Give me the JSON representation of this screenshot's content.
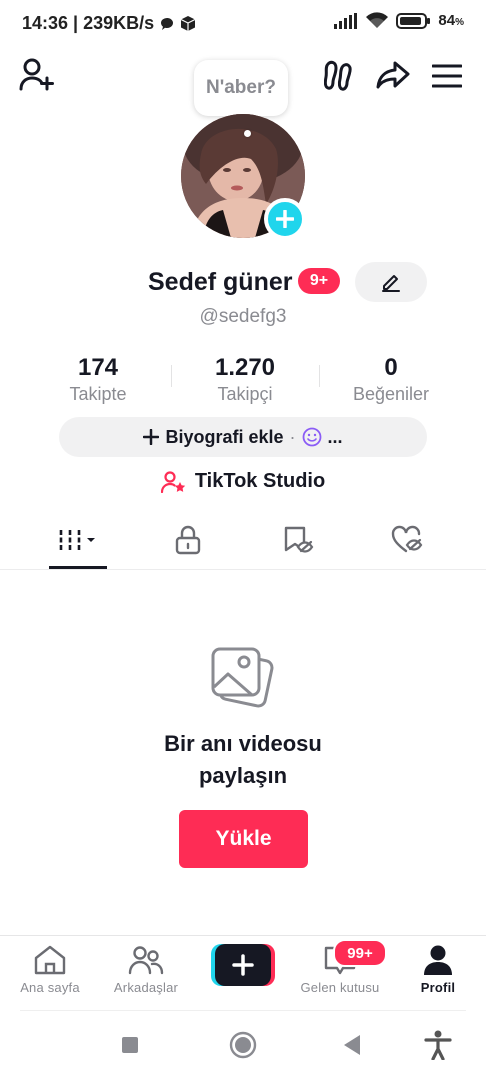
{
  "status": {
    "time_speed": "14:36 | 239KB/s",
    "battery": "84",
    "battery_unit": "%",
    "icons": [
      "chat-bubble-icon",
      "package-icon",
      "signal-icon",
      "wifi-icon",
      "battery-icon"
    ]
  },
  "header": {
    "icons": [
      "add-friend-icon",
      "footprints-icon",
      "share-icon",
      "menu-icon"
    ],
    "note_bubble": "N'aber?"
  },
  "profile": {
    "name": "Sedef güner",
    "notif_badge": "9+",
    "handle": "@sedefg3",
    "stats": [
      {
        "value": "174",
        "label": "Takipte"
      },
      {
        "value": "1.270",
        "label": "Takipçi"
      },
      {
        "value": "0",
        "label": "Beğeniler"
      }
    ],
    "bio_button": "Biyografi ekle",
    "bio_sep": "·",
    "bio_more": "...",
    "studio": "TikTok Studio"
  },
  "tabs": [
    "videos-grid-icon",
    "lock-icon",
    "saved-icon",
    "liked-icon"
  ],
  "empty": {
    "title_line1": "Bir anı videosu",
    "title_line2": "paylaşın",
    "button": "Yükle"
  },
  "bottom_nav": {
    "items": [
      {
        "label": "Ana sayfa",
        "icon": "home-icon"
      },
      {
        "label": "Arkadaşlar",
        "icon": "friends-icon"
      },
      {
        "label": "",
        "icon": "create-icon"
      },
      {
        "label": "Gelen kutusu",
        "icon": "inbox-icon",
        "badge": "99+"
      },
      {
        "label": "Profil",
        "icon": "profile-icon"
      }
    ]
  },
  "colors": {
    "accent": "#fe2c55",
    "cyan": "#20d5ec",
    "text": "#161823",
    "muted": "#8a8b91"
  }
}
